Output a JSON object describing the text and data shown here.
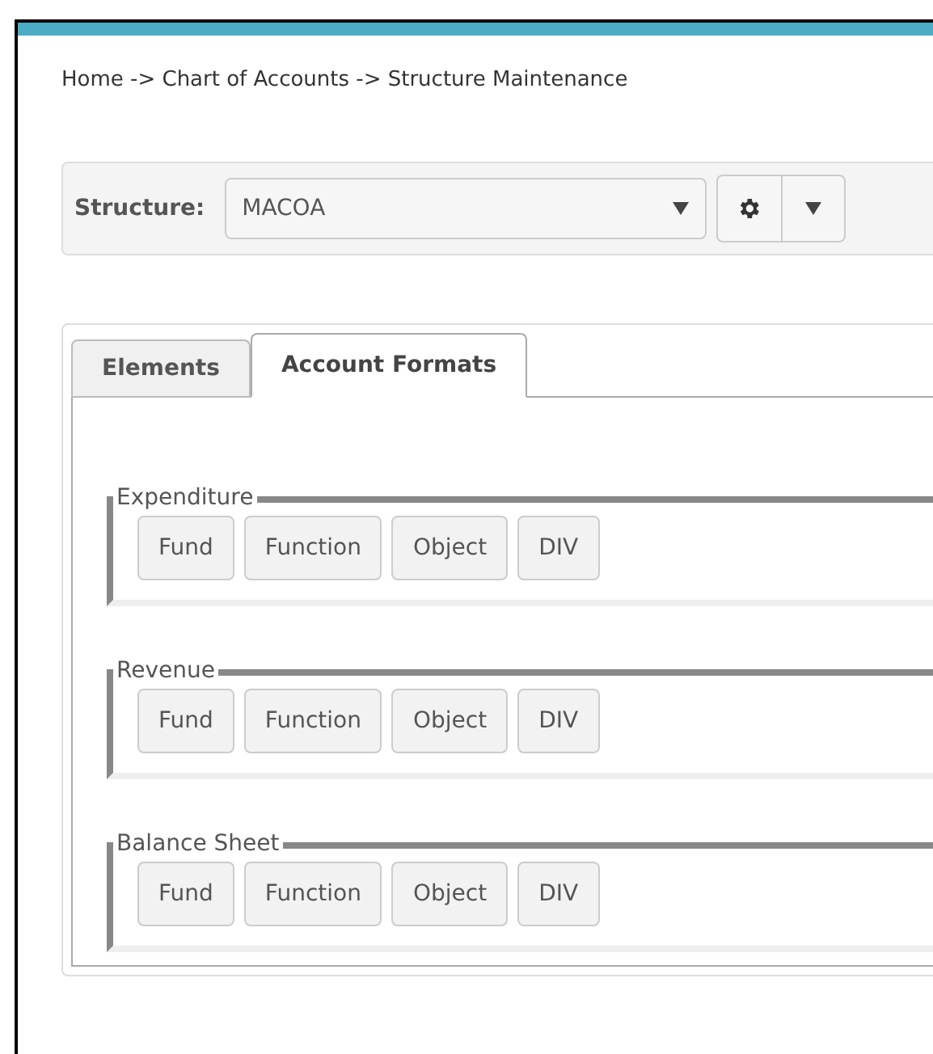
{
  "breadcrumb": "Home -> Chart of Accounts -> Structure Maintenance",
  "structure": {
    "label": "Structure:",
    "value": "MACOA"
  },
  "tabs": [
    {
      "label": "Elements",
      "selected": false
    },
    {
      "label": "Account Formats",
      "selected": true
    }
  ],
  "formats": [
    {
      "legend": "Expenditure",
      "segments": [
        "Fund",
        "Function",
        "Object",
        "DIV"
      ]
    },
    {
      "legend": "Revenue",
      "segments": [
        "Fund",
        "Function",
        "Object",
        "DIV"
      ]
    },
    {
      "legend": "Balance Sheet",
      "segments": [
        "Fund",
        "Function",
        "Object",
        "DIV"
      ]
    }
  ]
}
